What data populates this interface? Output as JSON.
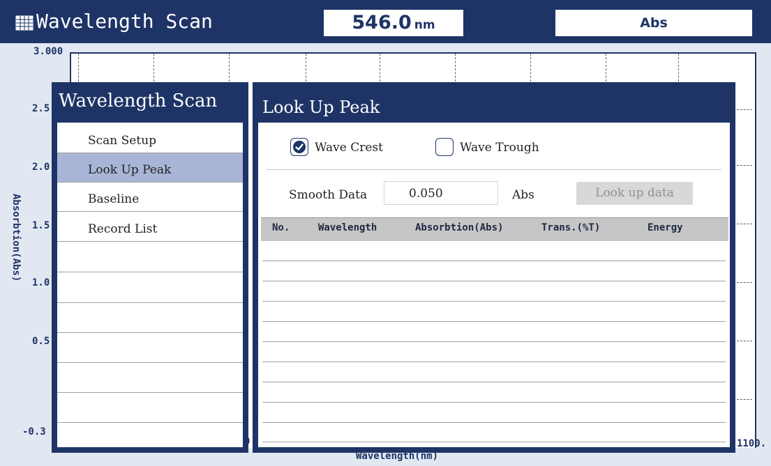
{
  "header": {
    "title": "Wavelength Scan",
    "icon": "grid-table-icon",
    "wavelength_value": "546.0",
    "wavelength_unit": "nm",
    "mode": "Abs"
  },
  "chart": {
    "y_ticks": [
      "3.000",
      "2.5",
      "2.0",
      "1.5",
      "1.0",
      "0.5",
      "-0.3"
    ],
    "y_axis_title": "Absorbtion(Abs)",
    "x_axis_title": "Wavelength(nm)",
    "x_tick_right": "1100.",
    "x_tick_left_fragment": "0"
  },
  "menu": {
    "title": "Wavelength Scan",
    "items": [
      {
        "label": "Scan Setup",
        "active": false
      },
      {
        "label": "Look Up Peak",
        "active": true
      },
      {
        "label": "Baseline",
        "active": false
      },
      {
        "label": "Record List",
        "active": false
      }
    ]
  },
  "dialog": {
    "title": "Look Up Peak",
    "wave_crest": {
      "label": "Wave Crest",
      "checked": true
    },
    "wave_trough": {
      "label": "Wave Trough",
      "checked": false
    },
    "smooth_label": "Smooth Data",
    "smooth_value": "0.050",
    "smooth_unit": "Abs",
    "lookup_button": "Look up data",
    "table": {
      "columns": [
        "No.",
        "Wavelength",
        "Absorbtion(Abs)",
        "Trans.(%T)",
        "Energy"
      ],
      "rows": []
    }
  },
  "colors": {
    "header_bg": "#1e3466",
    "selected_item": "#a8b5d6",
    "table_header": "#c6c6c6"
  }
}
